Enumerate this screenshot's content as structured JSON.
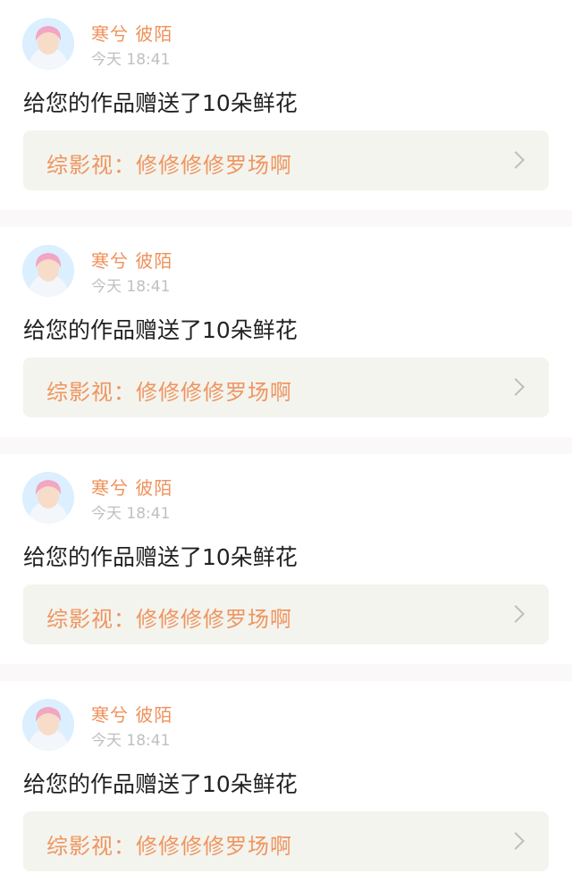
{
  "notifications": [
    {
      "user_name": "寒兮 彼陌",
      "time": "今天 18:41",
      "message": "给您的作品赠送了10朵鲜花",
      "work_title": "综影视：修修修修罗场啊"
    },
    {
      "user_name": "寒兮 彼陌",
      "time": "今天 18:41",
      "message": "给您的作品赠送了10朵鲜花",
      "work_title": "综影视：修修修修罗场啊"
    },
    {
      "user_name": "寒兮 彼陌",
      "time": "今天 18:41",
      "message": "给您的作品赠送了10朵鲜花",
      "work_title": "综影视：修修修修罗场啊"
    },
    {
      "user_name": "寒兮 彼陌",
      "time": "今天 18:41",
      "message": "给您的作品赠送了10朵鲜花",
      "work_title": "综影视：修修修修罗场啊"
    }
  ],
  "colors": {
    "user_name": "#f0915a",
    "time": "#c0c0c0",
    "message": "#222222",
    "work_title": "#ef9560",
    "work_link_bg": "#f4f4ee",
    "separator": "#faf8f8"
  },
  "icons": {
    "avatar": "user-avatar-portrait",
    "link_arrow": "chevron-right-icon"
  }
}
